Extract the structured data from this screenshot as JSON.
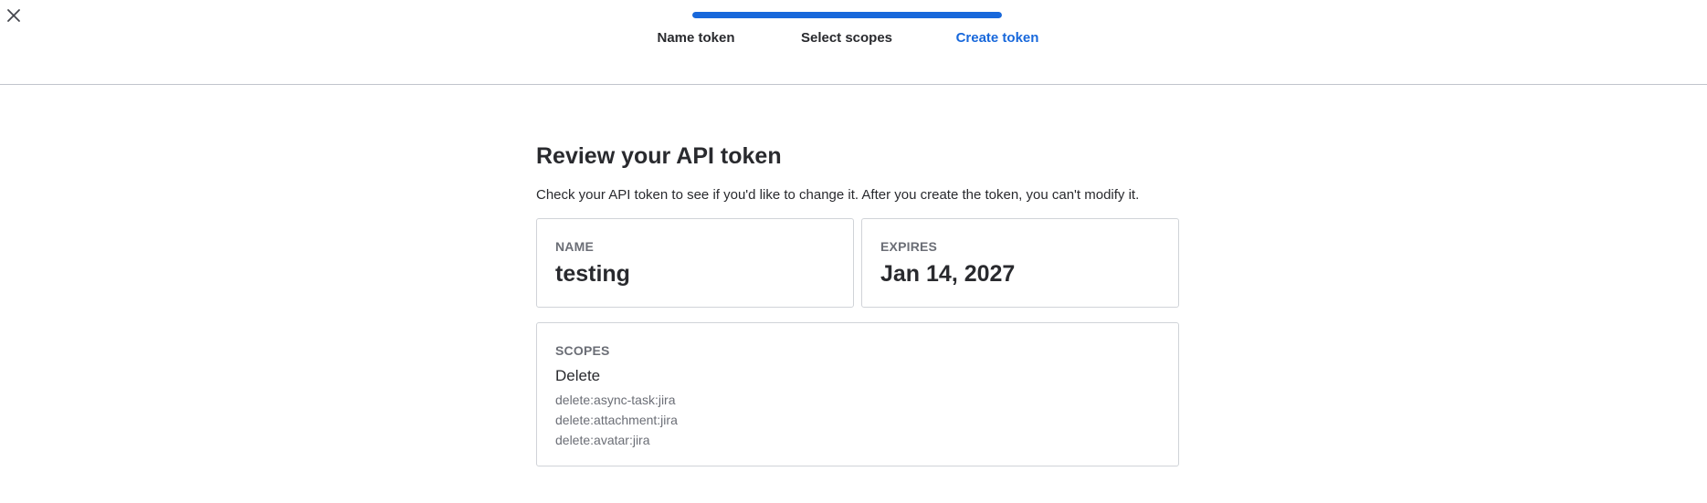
{
  "header": {
    "close_icon": "close-icon",
    "progress": 1.0,
    "accent_color": "#1868db",
    "steps": [
      {
        "label": "Name token",
        "state": "done"
      },
      {
        "label": "Select scopes",
        "state": "done"
      },
      {
        "label": "Create token",
        "state": "active"
      }
    ]
  },
  "main": {
    "title": "Review your API token",
    "description": "Check your API token to see if you'd like to change it. After you create the token, you can't modify it.",
    "name_card": {
      "label": "NAME",
      "value": "testing"
    },
    "expires_card": {
      "label": "EXPIRES",
      "value": "Jan 14, 2027"
    },
    "scopes_card": {
      "label": "SCOPES",
      "group": "Delete",
      "items": [
        "delete:async-task:jira",
        "delete:attachment:jira",
        "delete:avatar:jira"
      ]
    }
  }
}
